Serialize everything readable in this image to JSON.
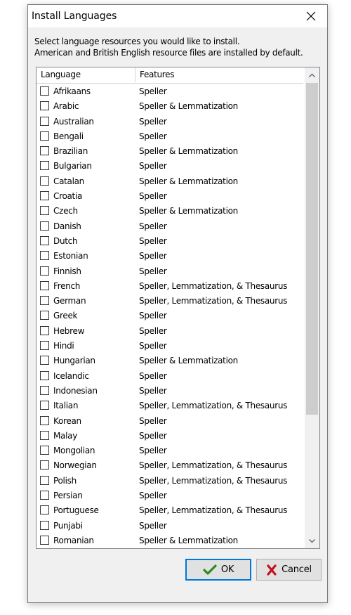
{
  "window": {
    "title": "Install Languages"
  },
  "instructions": {
    "line1": "Select language resources you would like to install.",
    "line2": "American and British English resource files are installed by default."
  },
  "list": {
    "columns": {
      "language": "Language",
      "features": "Features"
    },
    "rows": [
      {
        "language": "Afrikaans",
        "features": "Speller",
        "checked": false
      },
      {
        "language": "Arabic",
        "features": "Speller & Lemmatization",
        "checked": false
      },
      {
        "language": "Australian",
        "features": "Speller",
        "checked": false
      },
      {
        "language": "Bengali",
        "features": "Speller",
        "checked": false
      },
      {
        "language": "Brazilian",
        "features": "Speller & Lemmatization",
        "checked": false
      },
      {
        "language": "Bulgarian",
        "features": "Speller",
        "checked": false
      },
      {
        "language": "Catalan",
        "features": "Speller & Lemmatization",
        "checked": false
      },
      {
        "language": "Croatia",
        "features": "Speller",
        "checked": false
      },
      {
        "language": "Czech",
        "features": "Speller & Lemmatization",
        "checked": false
      },
      {
        "language": "Danish",
        "features": "Speller",
        "checked": false
      },
      {
        "language": "Dutch",
        "features": "Speller",
        "checked": false
      },
      {
        "language": "Estonian",
        "features": "Speller",
        "checked": false
      },
      {
        "language": "Finnish",
        "features": "Speller",
        "checked": false
      },
      {
        "language": "French",
        "features": "Speller, Lemmatization, & Thesaurus",
        "checked": false
      },
      {
        "language": "German",
        "features": "Speller, Lemmatization, & Thesaurus",
        "checked": false
      },
      {
        "language": "Greek",
        "features": "Speller",
        "checked": false
      },
      {
        "language": "Hebrew",
        "features": "Speller",
        "checked": false
      },
      {
        "language": "Hindi",
        "features": "Speller",
        "checked": false
      },
      {
        "language": "Hungarian",
        "features": "Speller & Lemmatization",
        "checked": false
      },
      {
        "language": "Icelandic",
        "features": "Speller",
        "checked": false
      },
      {
        "language": "Indonesian",
        "features": "Speller",
        "checked": false
      },
      {
        "language": "Italian",
        "features": "Speller, Lemmatization, & Thesaurus",
        "checked": false
      },
      {
        "language": "Korean",
        "features": "Speller",
        "checked": false
      },
      {
        "language": "Malay",
        "features": "Speller",
        "checked": false
      },
      {
        "language": "Mongolian",
        "features": "Speller",
        "checked": false
      },
      {
        "language": "Norwegian",
        "features": "Speller, Lemmatization, & Thesaurus",
        "checked": false
      },
      {
        "language": "Polish",
        "features": "Speller, Lemmatization, & Thesaurus",
        "checked": false
      },
      {
        "language": "Persian",
        "features": "Speller",
        "checked": false
      },
      {
        "language": "Portuguese",
        "features": "Speller, Lemmatization, & Thesaurus",
        "checked": false
      },
      {
        "language": "Punjabi",
        "features": "Speller",
        "checked": false
      },
      {
        "language": "Romanian",
        "features": "Speller & Lemmatization",
        "checked": false
      }
    ]
  },
  "buttons": {
    "ok_label": "OK",
    "cancel_label": "Cancel",
    "ok_icon": "checkmark-icon",
    "cancel_icon": "x-mark-icon"
  },
  "colors": {
    "ok_check": "#2e8b1e",
    "cancel_x": "#c1121f",
    "focus_border": "#0078d7"
  }
}
